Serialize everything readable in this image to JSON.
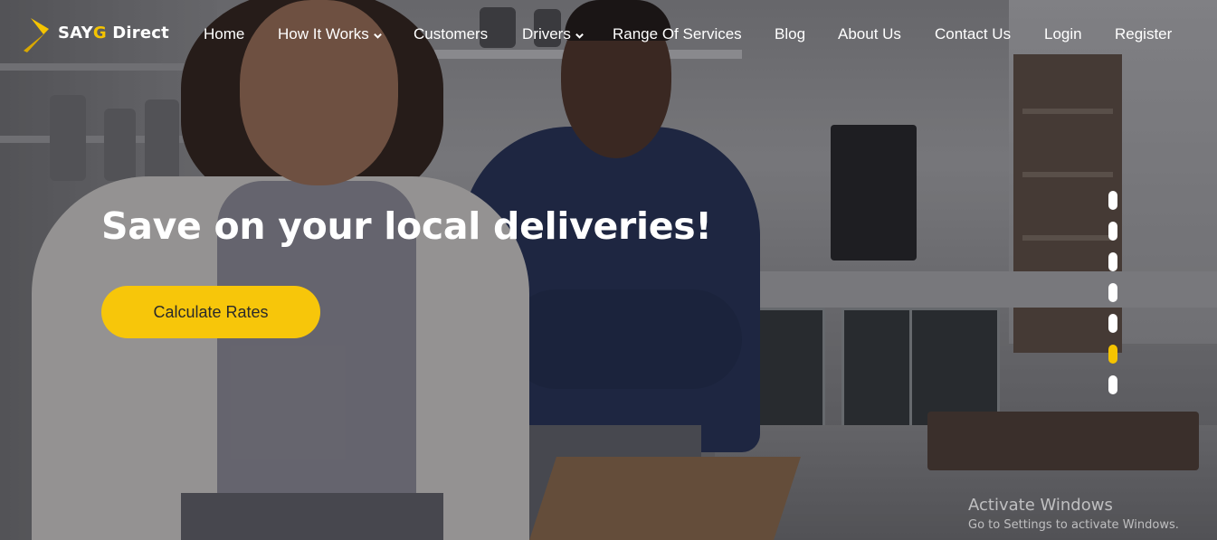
{
  "brand": {
    "name_prefix": "SAY",
    "name_accent": "G",
    "name_suffix": " Direct",
    "accent_color": "#f5c400"
  },
  "nav": {
    "items": [
      {
        "label": "Home",
        "has_dropdown": false
      },
      {
        "label": "How It Works",
        "has_dropdown": true
      },
      {
        "label": "Customers",
        "has_dropdown": false
      },
      {
        "label": "Drivers",
        "has_dropdown": true
      },
      {
        "label": "Range Of Services",
        "has_dropdown": false
      },
      {
        "label": "Blog",
        "has_dropdown": false
      },
      {
        "label": "About Us",
        "has_dropdown": false
      },
      {
        "label": "Contact Us",
        "has_dropdown": false
      },
      {
        "label": "Login",
        "has_dropdown": false
      },
      {
        "label": "Register",
        "has_dropdown": false
      }
    ]
  },
  "hero": {
    "headline": "Save on your local deliveries!",
    "cta_label": "Calculate Rates",
    "cta_color": "#f7c60a",
    "background_image": "smiling-cafe-staff-photo"
  },
  "slider": {
    "total_slides": 7,
    "active_index": 5
  },
  "watermark": {
    "title": "Activate Windows",
    "subtitle": "Go to Settings to activate Windows."
  }
}
